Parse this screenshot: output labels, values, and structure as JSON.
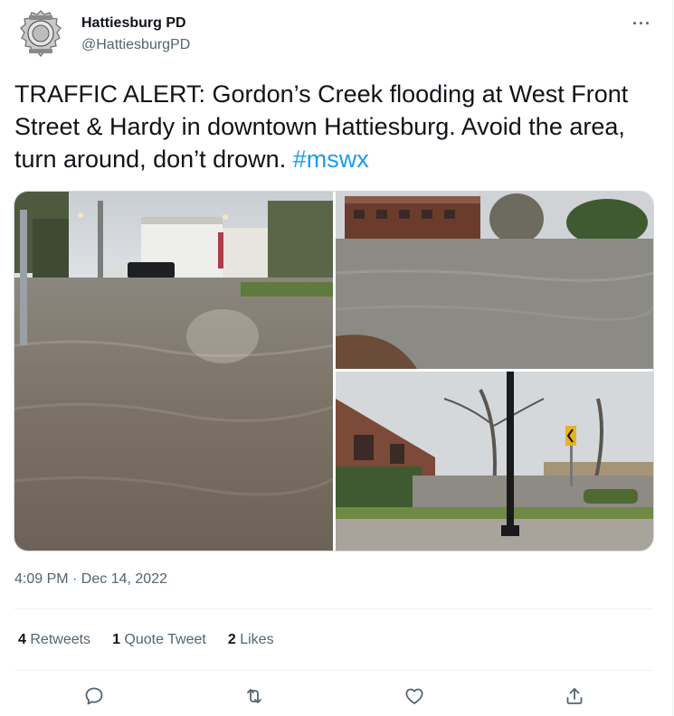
{
  "author": {
    "name": "Hattiesburg PD",
    "handle": "@HattiesburgPD",
    "avatar_icon": "police-badge-icon"
  },
  "menu_icon": "more-options-icon",
  "more_label": "···",
  "tweet": {
    "text": "TRAFFIC ALERT: Gordon’s Creek flooding at West Front Street & Hardy in downtown Hattiesburg. Avoid the area, turn around, don’t drown.",
    "hashtag": "#mswx"
  },
  "media": {
    "photos": [
      {
        "icon": "flooded-street-photo"
      },
      {
        "icon": "flooded-park-photo"
      },
      {
        "icon": "flooded-building-photo"
      }
    ]
  },
  "timestamp": "4:09 PM · Dec 14, 2022",
  "stats": {
    "retweets": {
      "count": "4",
      "label": "Retweets"
    },
    "quote_tweets": {
      "count": "1",
      "label": "Quote Tweet"
    },
    "likes": {
      "count": "2",
      "label": "Likes"
    }
  },
  "actions": [
    "reply-icon",
    "retweet-icon",
    "like-icon",
    "share-icon"
  ],
  "colors": {
    "accent": "#1d9bf0",
    "text": "#0f1419",
    "muted": "#536471",
    "border": "#cfd9de"
  }
}
